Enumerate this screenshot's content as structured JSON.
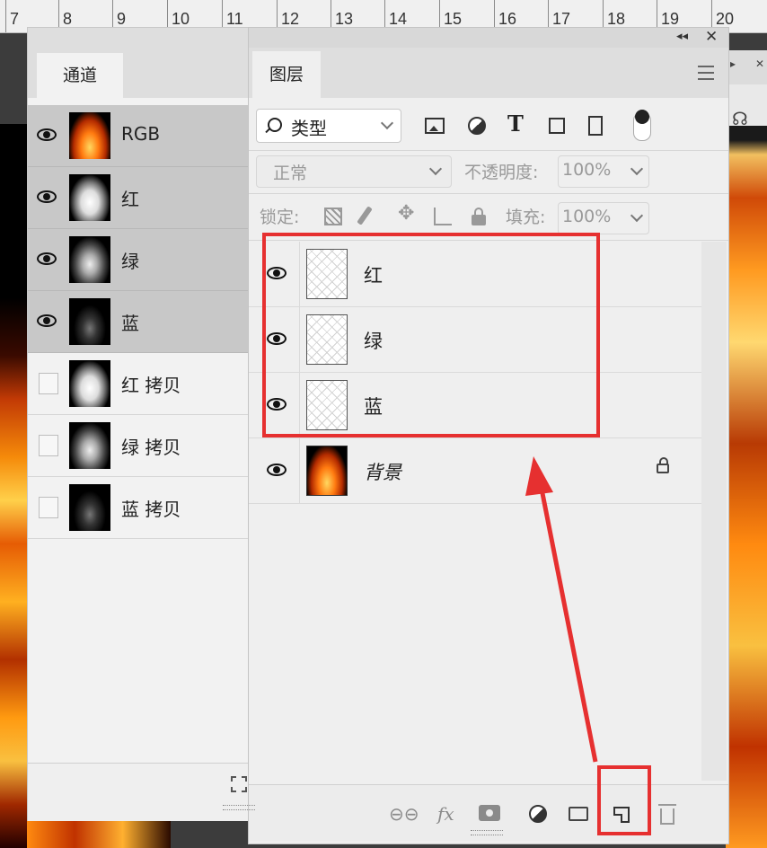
{
  "ruler": {
    "ticks": [
      "7",
      "8",
      "9",
      "10",
      "11",
      "12",
      "13",
      "14",
      "15",
      "16",
      "17",
      "18",
      "19",
      "20"
    ]
  },
  "channels_panel": {
    "tab": "通道",
    "items": [
      {
        "label": "RGB",
        "visible": true,
        "selected": true
      },
      {
        "label": "红",
        "visible": true,
        "selected": true
      },
      {
        "label": "绿",
        "visible": true,
        "selected": true
      },
      {
        "label": "蓝",
        "visible": true,
        "selected": true
      },
      {
        "label": "红 拷贝",
        "visible": false,
        "selected": false
      },
      {
        "label": "绿 拷贝",
        "visible": false,
        "selected": false
      },
      {
        "label": "蓝 拷贝",
        "visible": false,
        "selected": false
      }
    ]
  },
  "layers_panel": {
    "tab": "图层",
    "filter": {
      "label": "类型"
    },
    "blend_mode": "正常",
    "opacity_label": "不透明度:",
    "opacity_value": "100%",
    "lock_label": "锁定:",
    "fill_label": "填充:",
    "fill_value": "100%",
    "layers": [
      {
        "name": "红",
        "visible": true
      },
      {
        "name": "绿",
        "visible": true
      },
      {
        "name": "蓝",
        "visible": true
      },
      {
        "name": "背景",
        "visible": true,
        "locked": true
      }
    ]
  },
  "colors": {
    "highlight": "#e63030",
    "panel_bg": "#efefef",
    "selected_row": "#c8c8c8"
  },
  "icons": [
    "eye-icon",
    "search-icon",
    "image-filter-icon",
    "adjustment-filter-icon",
    "type-filter-icon",
    "shape-filter-icon",
    "smart-object-filter-icon",
    "lock-icon",
    "link-icon",
    "fx-icon",
    "mask-icon",
    "adjustment-layer-icon",
    "folder-icon",
    "new-layer-icon",
    "trash-icon"
  ]
}
